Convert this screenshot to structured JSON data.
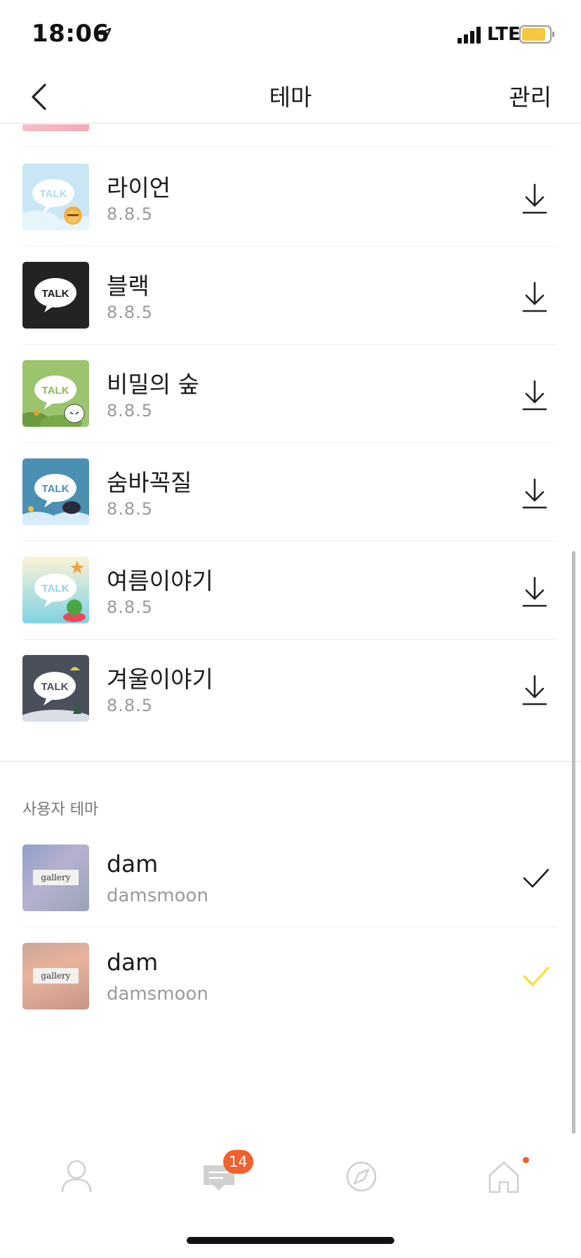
{
  "status_bar": {
    "time": "18:06",
    "network": "LTE"
  },
  "nav": {
    "title": "테마",
    "manage_label": "관리"
  },
  "themes": [
    {
      "name": "라이언",
      "version": "8.8.5",
      "thumb_text": "TALK"
    },
    {
      "name": "블랙",
      "version": "8.8.5",
      "thumb_text": "TALK"
    },
    {
      "name": "비밀의 숲",
      "version": "8.8.5",
      "thumb_text": "TALK"
    },
    {
      "name": "숨바꼭질",
      "version": "8.8.5",
      "thumb_text": "TALK"
    },
    {
      "name": "여름이야기",
      "version": "8.8.5",
      "thumb_text": "TALK"
    },
    {
      "name": "겨울이야기",
      "version": "8.8.5",
      "thumb_text": "TALK"
    }
  ],
  "user_section": {
    "label": "사용자 테마",
    "items": [
      {
        "name": "dam",
        "author": "damsmoon",
        "thumb_text": "gallery",
        "check_color": "#1c1c1c"
      },
      {
        "name": "dam",
        "author": "damsmoon",
        "thumb_text": "gallery",
        "check_color": "#f7e03a"
      }
    ]
  },
  "tab_bar": {
    "chat_badge": "14",
    "tabs": [
      "profile-icon",
      "chat-icon",
      "compass-icon",
      "home-icon"
    ]
  },
  "colors": {
    "accent": "#f7e03a",
    "badge": "#f0612e"
  }
}
